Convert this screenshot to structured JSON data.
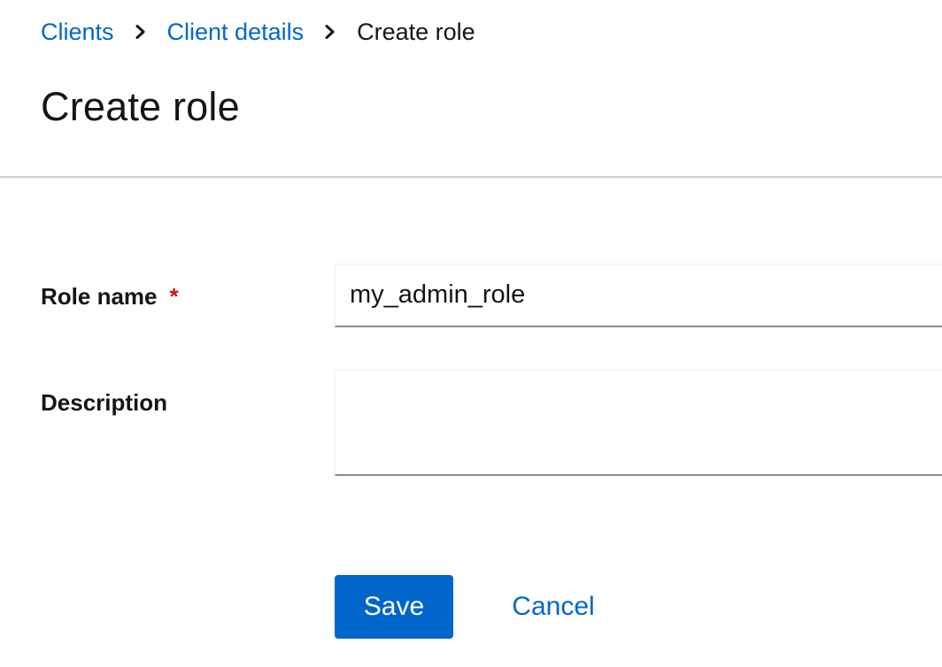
{
  "breadcrumb": {
    "items": [
      {
        "label": "Clients",
        "is_link": true
      },
      {
        "label": "Client details",
        "is_link": true
      },
      {
        "label": "Create role",
        "is_link": false
      }
    ],
    "separator_icon": "chevron-right-icon"
  },
  "page": {
    "title": "Create role"
  },
  "form": {
    "role_name": {
      "label": "Role name",
      "required_marker": "*",
      "value": "my_admin_role"
    },
    "description": {
      "label": "Description",
      "value": ""
    }
  },
  "actions": {
    "save_label": "Save",
    "cancel_label": "Cancel"
  },
  "colors": {
    "link": "#0066cc",
    "primary_button": "#0066cc",
    "required": "#c9190b",
    "divider": "#d2d2d2"
  }
}
